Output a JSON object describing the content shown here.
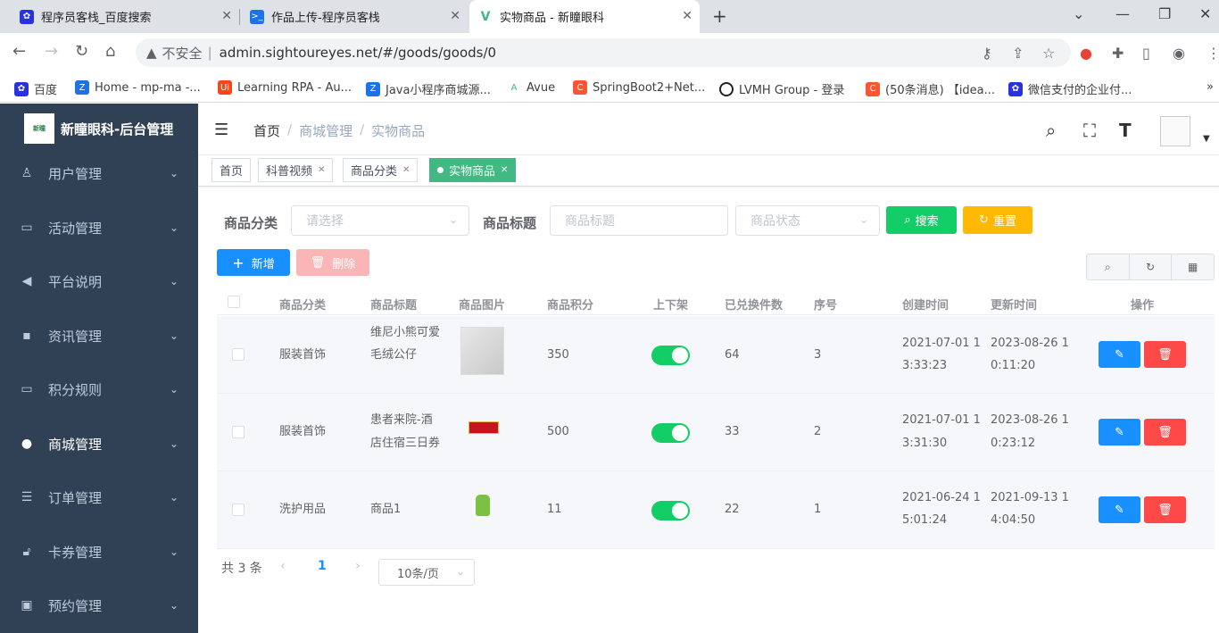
{
  "browser": {
    "tabs": [
      {
        "title": "程序员客栈_百度搜索"
      },
      {
        "title": "作品上传-程序员客栈"
      },
      {
        "title": "实物商品 - 新瞳眼科"
      }
    ],
    "address": {
      "security": "不安全",
      "url": "admin.sightoureyes.net/#/goods/goods/0"
    },
    "bookmarks": [
      "百度",
      "Home - mp-ma -...",
      "Learning RPA - Au...",
      "Java小程序商城源...",
      "Avue",
      "SpringBoot2+Net...",
      "LVMH Group - 登录",
      "(50条消息) 【idea...",
      "微信支付的企业付..."
    ]
  },
  "app": {
    "logo_text": "新瞳眼科-后台管理",
    "sidebar": [
      {
        "label": "用户管理",
        "icon": "user-icon"
      },
      {
        "label": "活动管理",
        "icon": "monitor-icon"
      },
      {
        "label": "平台说明",
        "icon": "speaker-icon"
      },
      {
        "label": "资讯管理",
        "icon": "message-icon"
      },
      {
        "label": "积分规则",
        "icon": "monitor-icon"
      },
      {
        "label": "商城管理",
        "icon": "globe-icon"
      },
      {
        "label": "订单管理",
        "icon": "list-icon"
      },
      {
        "label": "卡券管理",
        "icon": "lock-icon"
      },
      {
        "label": "预约管理",
        "icon": "calendar-icon"
      }
    ],
    "breadcrumb": [
      "首页",
      "商城管理",
      "实物商品"
    ],
    "tags": [
      "首页",
      "科普视频",
      "商品分类",
      "实物商品"
    ],
    "filters": {
      "category_label": "商品分类",
      "category_placeholder": "请选择",
      "title_label": "商品标题",
      "title_placeholder": "商品标题",
      "status_placeholder": "商品状态",
      "search_btn": "搜索",
      "reset_btn": "重置"
    },
    "actions": {
      "add": "新增",
      "delete": "删除"
    },
    "table": {
      "headers": [
        "商品分类",
        "商品标题",
        "商品图片",
        "商品积分",
        "上下架",
        "已兑换件数",
        "序号",
        "创建时间",
        "更新时间",
        "操作"
      ],
      "rows": [
        {
          "category": "服装首饰",
          "title1": "维尼小熊可爱",
          "title2": "毛绒公仔",
          "points": "350",
          "on_shelf": true,
          "redeemed": "64",
          "order": "3",
          "created1": "2021-07-01 1",
          "created2": "3:33:23",
          "updated1": "2023-08-26 1",
          "updated2": "0:11:20"
        },
        {
          "category": "服装首饰",
          "title1": "患者来院-酒",
          "title2": "店住宿三日券",
          "points": "500",
          "on_shelf": true,
          "redeemed": "33",
          "order": "2",
          "created1": "2021-07-01 1",
          "created2": "3:31:30",
          "updated1": "2023-08-26 1",
          "updated2": "0:23:12"
        },
        {
          "category": "洗护用品",
          "title1": "商品1",
          "title2": "",
          "points": "11",
          "on_shelf": true,
          "redeemed": "22",
          "order": "1",
          "created1": "2021-06-24 1",
          "created2": "5:01:24",
          "updated1": "2021-09-13 1",
          "updated2": "4:04:50"
        }
      ]
    },
    "pagination": {
      "total": "共 3 条",
      "current": "1",
      "page_size": "10条/页"
    }
  }
}
